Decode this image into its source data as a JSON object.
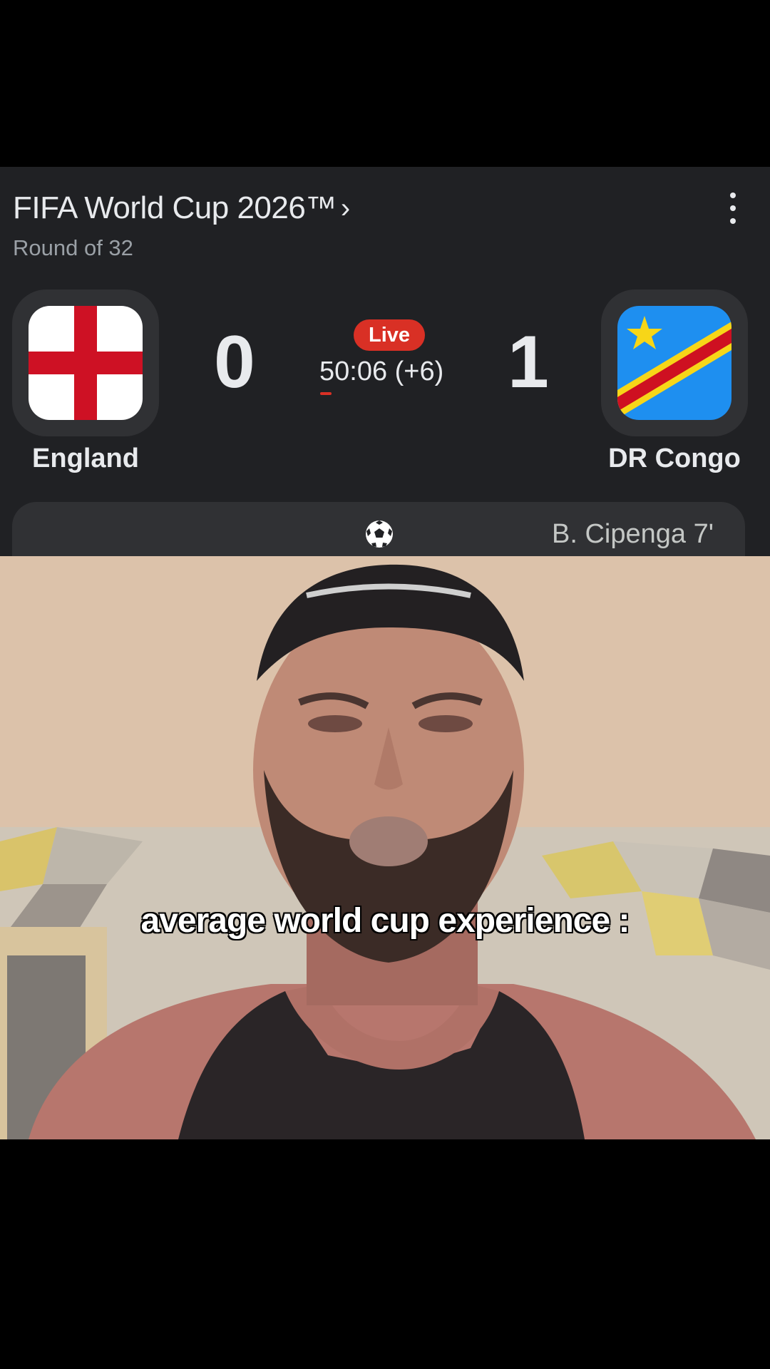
{
  "score_card": {
    "competition": "FIFA World Cup 2026™",
    "competition_chevron": "›",
    "stage": "Round of 32",
    "status_badge": "Live",
    "match_clock": "50:06 (+6)",
    "home": {
      "name": "England",
      "score": "0",
      "flag": "england-flag-icon"
    },
    "away": {
      "name": "DR Congo",
      "score": "1",
      "flag": "dr-congo-flag-icon"
    },
    "goal_events": [
      {
        "scorer": "B. Cipenga 7'",
        "icon": "soccer-ball-icon"
      }
    ],
    "colors": {
      "card_bg": "#202124",
      "chip_bg": "#303134",
      "live_red": "#d93025",
      "text": "#e8eaed",
      "muted": "#9aa0a6"
    }
  },
  "video": {
    "caption": "average world cup experience :"
  }
}
